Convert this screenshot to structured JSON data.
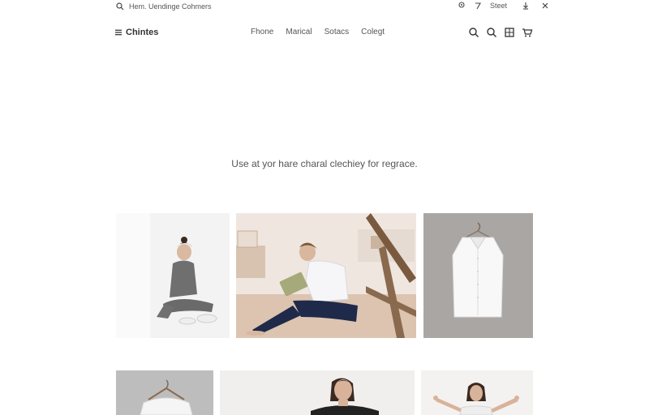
{
  "topbar": {
    "search_text": "Hem. Uendinge Cohmers",
    "street_label": "Steet"
  },
  "navbar": {
    "brand": "Chintes",
    "nav_items": [
      "Fhone",
      "Marical",
      "Sotacs",
      "Colegt"
    ]
  },
  "hero": {
    "tagline": "Use at yor hare charal clechiey for regrace."
  },
  "icons": {
    "top": [
      "search-icon",
      "location-icon",
      "send-icon",
      "download-icon",
      "close-icon"
    ],
    "nav": [
      "menu-icon",
      "search-icon",
      "search-icon",
      "grid-icon",
      "cart-icon"
    ]
  },
  "gallery": {
    "items": [
      {
        "name": "woman-sitting-floor"
      },
      {
        "name": "man-reading-tablet"
      },
      {
        "name": "white-sleeveless-blouse"
      },
      {
        "name": "white-top-on-hanger"
      },
      {
        "name": "woman-smiling"
      },
      {
        "name": "woman-arms-raised"
      }
    ]
  }
}
